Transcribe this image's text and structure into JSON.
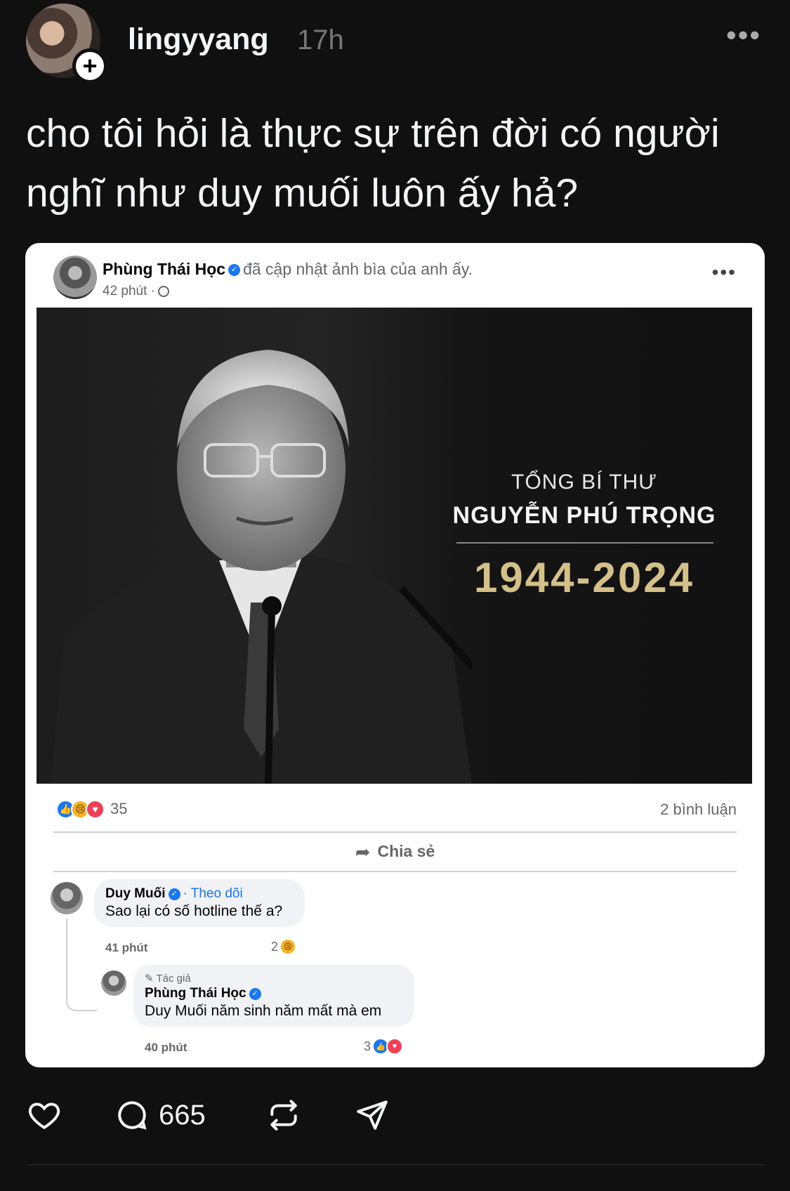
{
  "post": {
    "username": "lingyyang",
    "time": "17h",
    "more_icon": "more-horizontal-icon",
    "caption": "cho tôi hỏi là thực sự trên đời có người nghĩ như duy muối luôn ấy hả?"
  },
  "embed": {
    "author": "Phùng Thái Học",
    "action": "đã cập nhật ảnh bìa của anh ấy.",
    "time": "42 phút ·",
    "cover": {
      "title": "TỔNG BÍ THƯ",
      "name": "NGUYỄN PHÚ TRỌNG",
      "years": "1944-2024"
    },
    "reaction_count": "35",
    "comment_count": "2 bình luận",
    "share_label": "Chia sẻ",
    "comments": [
      {
        "name": "Duy Muối",
        "follow": "· Theo dõi",
        "text": "Sao lại có số hotline thế a?",
        "time": "41 phút",
        "reactions": "2"
      },
      {
        "author_tag": "Tác giả",
        "name": "Phùng Thái Học",
        "text": "Duy Muối năm sinh năm mất mà em",
        "time": "40 phút",
        "reactions": "3"
      }
    ]
  },
  "actions": {
    "like_icon": "heart-icon",
    "comment_icon": "comment-icon",
    "comment_count": "665",
    "repost_icon": "repost-icon",
    "share_icon": "send-icon"
  },
  "colors": {
    "background": "#101010",
    "text": "#f3f5f7",
    "muted": "#777777",
    "facebook_blue": "#1877f2",
    "years_gold": "#d6c08a"
  }
}
